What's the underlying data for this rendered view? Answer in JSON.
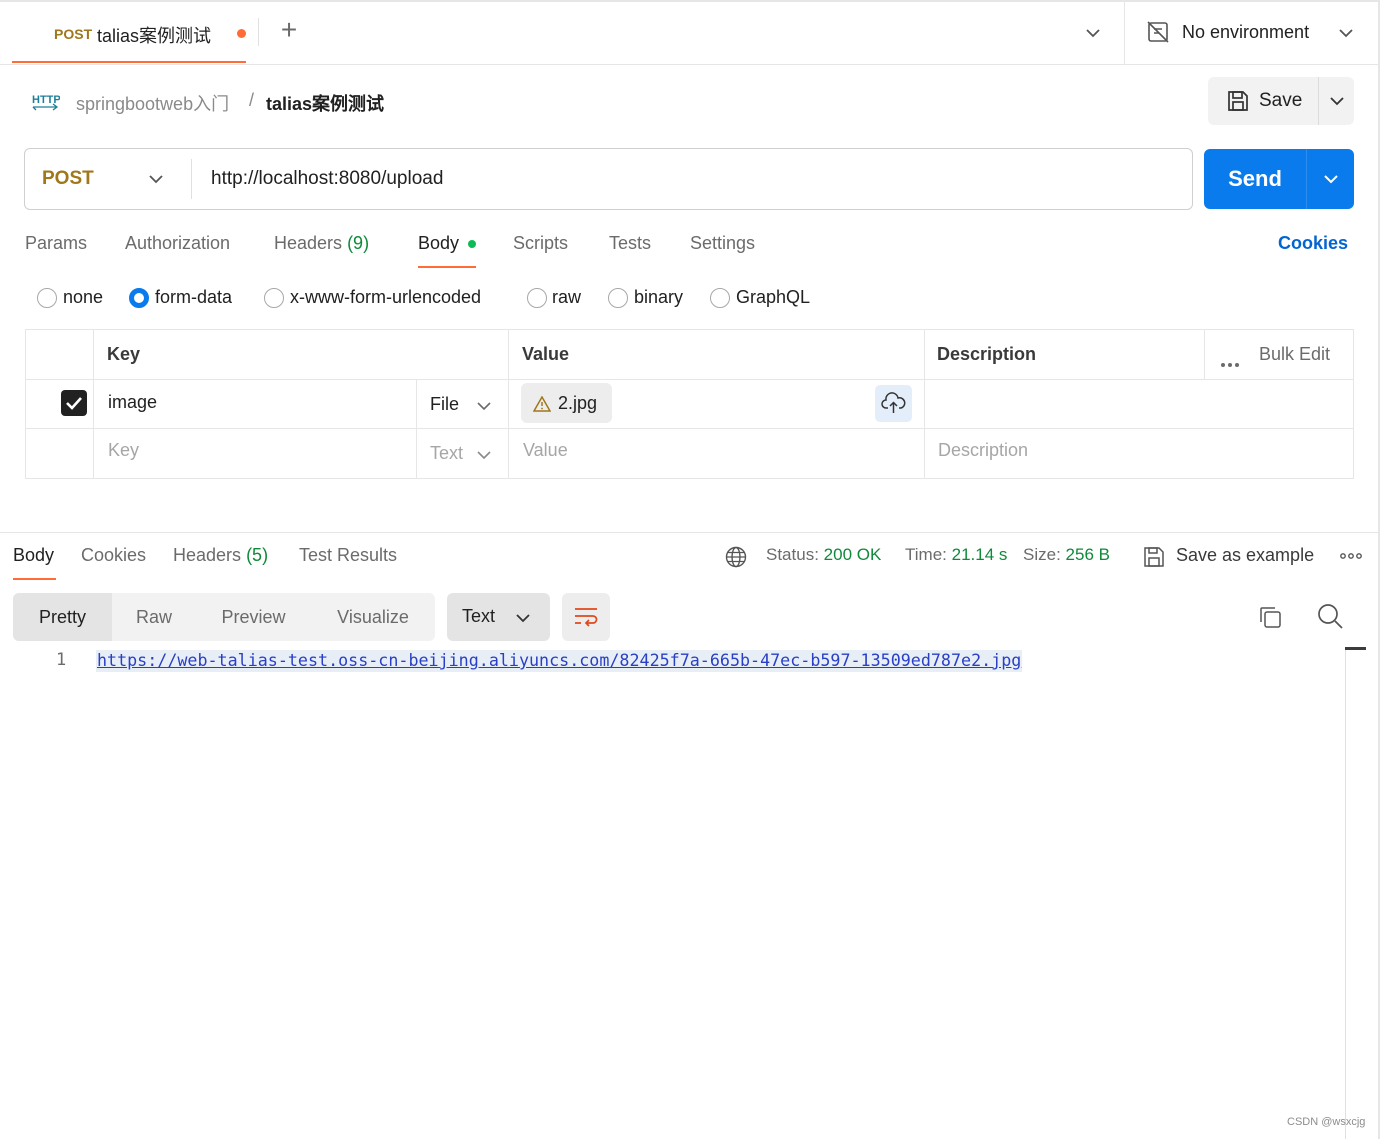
{
  "tab": {
    "method": "POST",
    "name": "talias案例测试",
    "new_tab": "+"
  },
  "environment": {
    "label": "No environment"
  },
  "breadcrumb": {
    "collection": "springbootweb入门",
    "separator": "/",
    "request": "talias案例测试"
  },
  "toolbar": {
    "save_label": "Save"
  },
  "request": {
    "method": "POST",
    "url": "http://localhost:8080/upload",
    "send_label": "Send"
  },
  "request_tabs": [
    {
      "label": "Params"
    },
    {
      "label": "Authorization"
    },
    {
      "label": "Headers",
      "count": "(9)"
    },
    {
      "label": "Body"
    },
    {
      "label": "Scripts"
    },
    {
      "label": "Tests"
    },
    {
      "label": "Settings"
    }
  ],
  "cookies_label": "Cookies",
  "body_types": [
    {
      "label": "none",
      "selected": false
    },
    {
      "label": "form-data",
      "selected": true
    },
    {
      "label": "x-www-form-urlencoded",
      "selected": false
    },
    {
      "label": "raw",
      "selected": false
    },
    {
      "label": "binary",
      "selected": false
    },
    {
      "label": "GraphQL",
      "selected": false
    }
  ],
  "form_table": {
    "headers": {
      "key": "Key",
      "value": "Value",
      "description": "Description",
      "bulk_edit": "Bulk Edit"
    },
    "rows": [
      {
        "checked": true,
        "key": "image",
        "type": "File",
        "value": "2.jpg",
        "description": ""
      }
    ],
    "new_row": {
      "key_placeholder": "Key",
      "type": "Text",
      "value_placeholder": "Value",
      "description_placeholder": "Description"
    }
  },
  "response_tabs": [
    {
      "label": "Body"
    },
    {
      "label": "Cookies"
    },
    {
      "label": "Headers",
      "count": "(5)"
    },
    {
      "label": "Test Results"
    }
  ],
  "response_meta": {
    "status_label": "Status:",
    "status_value": "200 OK",
    "time_label": "Time:",
    "time_value": "21.14 s",
    "size_label": "Size:",
    "size_value": "256 B",
    "save_example": "Save as example"
  },
  "view_modes": [
    "Pretty",
    "Raw",
    "Preview",
    "Visualize"
  ],
  "format": "Text",
  "response_body": {
    "line": "1",
    "text": "https://web-talias-test.oss-cn-beijing.aliyuncs.com/82425f7a-665b-47ec-b597-13509ed787e2.jpg"
  },
  "watermark": "CSDN @wsxcjg",
  "colors": {
    "accent": "#ff6c37",
    "send": "#097bed",
    "method": "#a0771a",
    "status_ok": "#0f8a3a",
    "link": "#2940c6"
  }
}
